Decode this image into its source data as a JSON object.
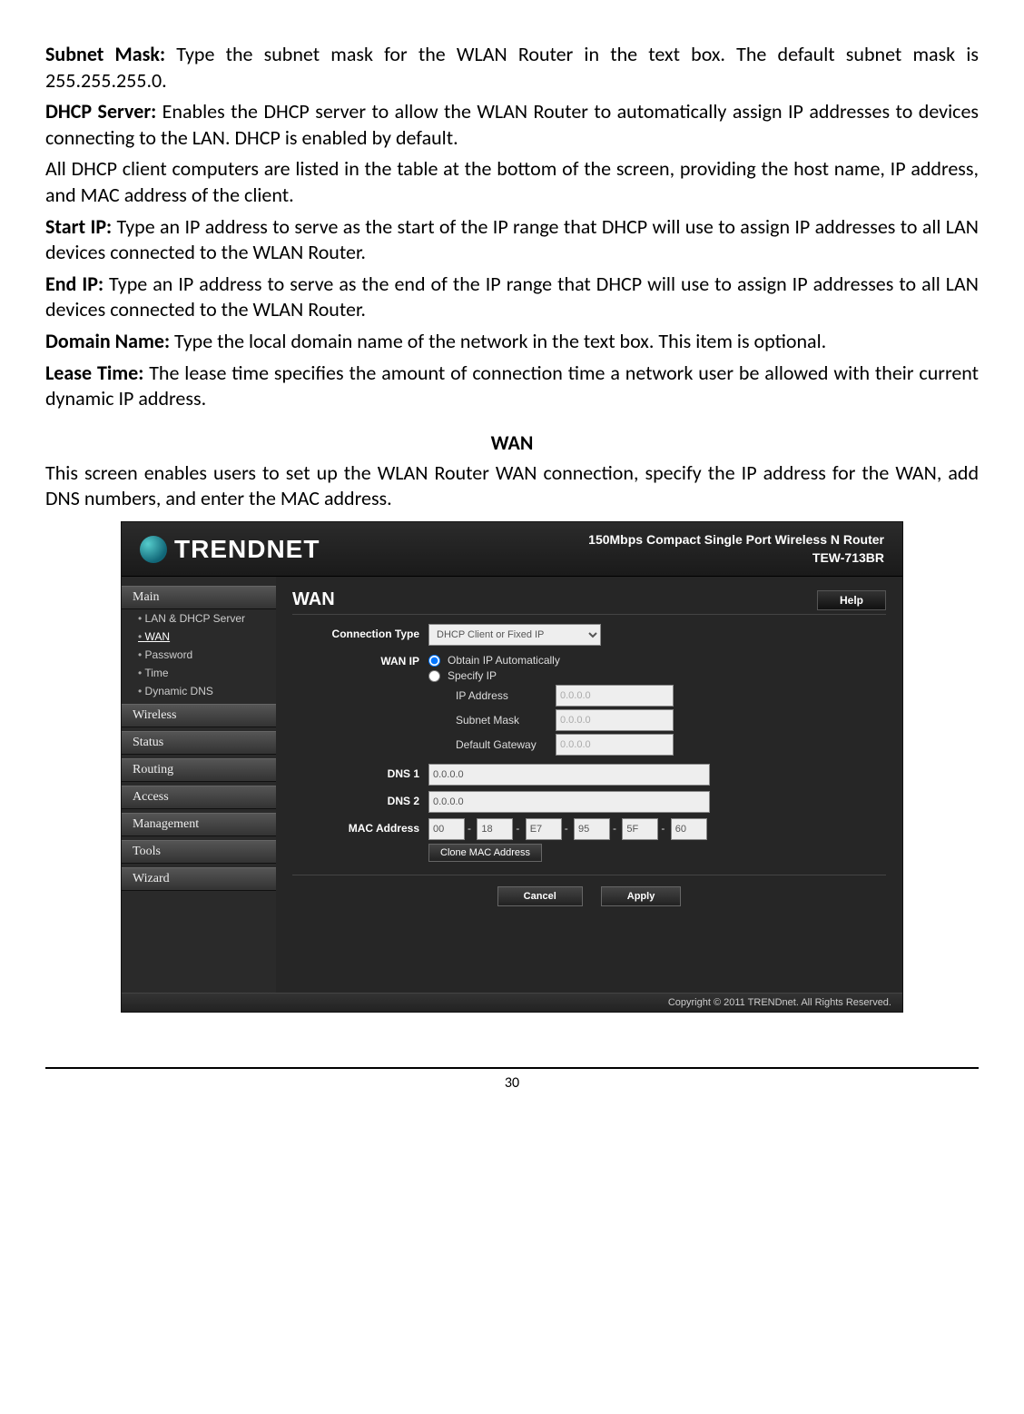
{
  "paragraphs": {
    "subnet_mask_label": "Subnet Mask:",
    "subnet_mask_body": " Type the subnet mask for the WLAN Router in the text box. The default subnet mask is 255.255.255.0.",
    "dhcp_server_label": "DHCP Server:",
    "dhcp_server_body": " Enables the DHCP server to allow the WLAN Router to automatically assign IP addresses to devices connecting to the LAN. DHCP is enabled by default.",
    "dhcp_clients_body": "All DHCP client computers are listed in the table at the bottom of the screen, providing the host name, IP address, and MAC address of the client.",
    "start_ip_label": "Start IP:",
    "start_ip_body": " Type an IP address to serve as the start of the IP range that DHCP will use to assign IP addresses to all LAN devices connected to the WLAN Router.",
    "end_ip_label": "End IP:",
    "end_ip_body": " Type an IP address to serve as the end of the IP range that DHCP will use to assign IP addresses to all LAN devices connected to the WLAN Router.",
    "domain_name_label": "Domain Name:",
    "domain_name_body": " Type the local domain name of the network in the text box. This item is optional.",
    "lease_time_label": "Lease Time:",
    "lease_time_body": "  The lease time specifies the amount of connection time a network user be allowed with their current dynamic IP address.",
    "wan_heading": "WAN",
    "wan_intro": "This screen enables users to set up the WLAN Router WAN connection, specify the IP address for the WAN, add DNS numbers, and enter the MAC address."
  },
  "router": {
    "brand": "TRENDNET",
    "model_line1": "150Mbps Compact Single Port Wireless N Router",
    "model_line2": "TEW-713BR",
    "sidebar": {
      "main": "Main",
      "items": [
        "LAN & DHCP Server",
        "WAN",
        "Password",
        "Time",
        "Dynamic DNS"
      ],
      "sections": [
        "Wireless",
        "Status",
        "Routing",
        "Access",
        "Management",
        "Tools",
        "Wizard"
      ]
    },
    "pane": {
      "title": "WAN",
      "help": "Help",
      "connection_type_label": "Connection Type",
      "connection_type_value": "DHCP Client or Fixed IP",
      "wan_ip_label": "WAN IP",
      "radio_auto": "Obtain IP Automatically",
      "radio_specify": "Specify IP",
      "ip_address_label": "IP Address",
      "ip_address_value": "0.0.0.0",
      "subnet_mask_label": "Subnet Mask",
      "subnet_mask_value": "0.0.0.0",
      "gateway_label": "Default Gateway",
      "gateway_value": "0.0.0.0",
      "dns1_label": "DNS 1",
      "dns1_value": "0.0.0.0",
      "dns2_label": "DNS 2",
      "dns2_value": "0.0.0.0",
      "mac_label": "MAC Address",
      "mac": [
        "00",
        "18",
        "E7",
        "95",
        "5F",
        "60"
      ],
      "clone": "Clone MAC Address",
      "cancel": "Cancel",
      "apply": "Apply"
    },
    "footer": "Copyright © 2011 TRENDnet. All Rights Reserved."
  },
  "page_number": "30"
}
